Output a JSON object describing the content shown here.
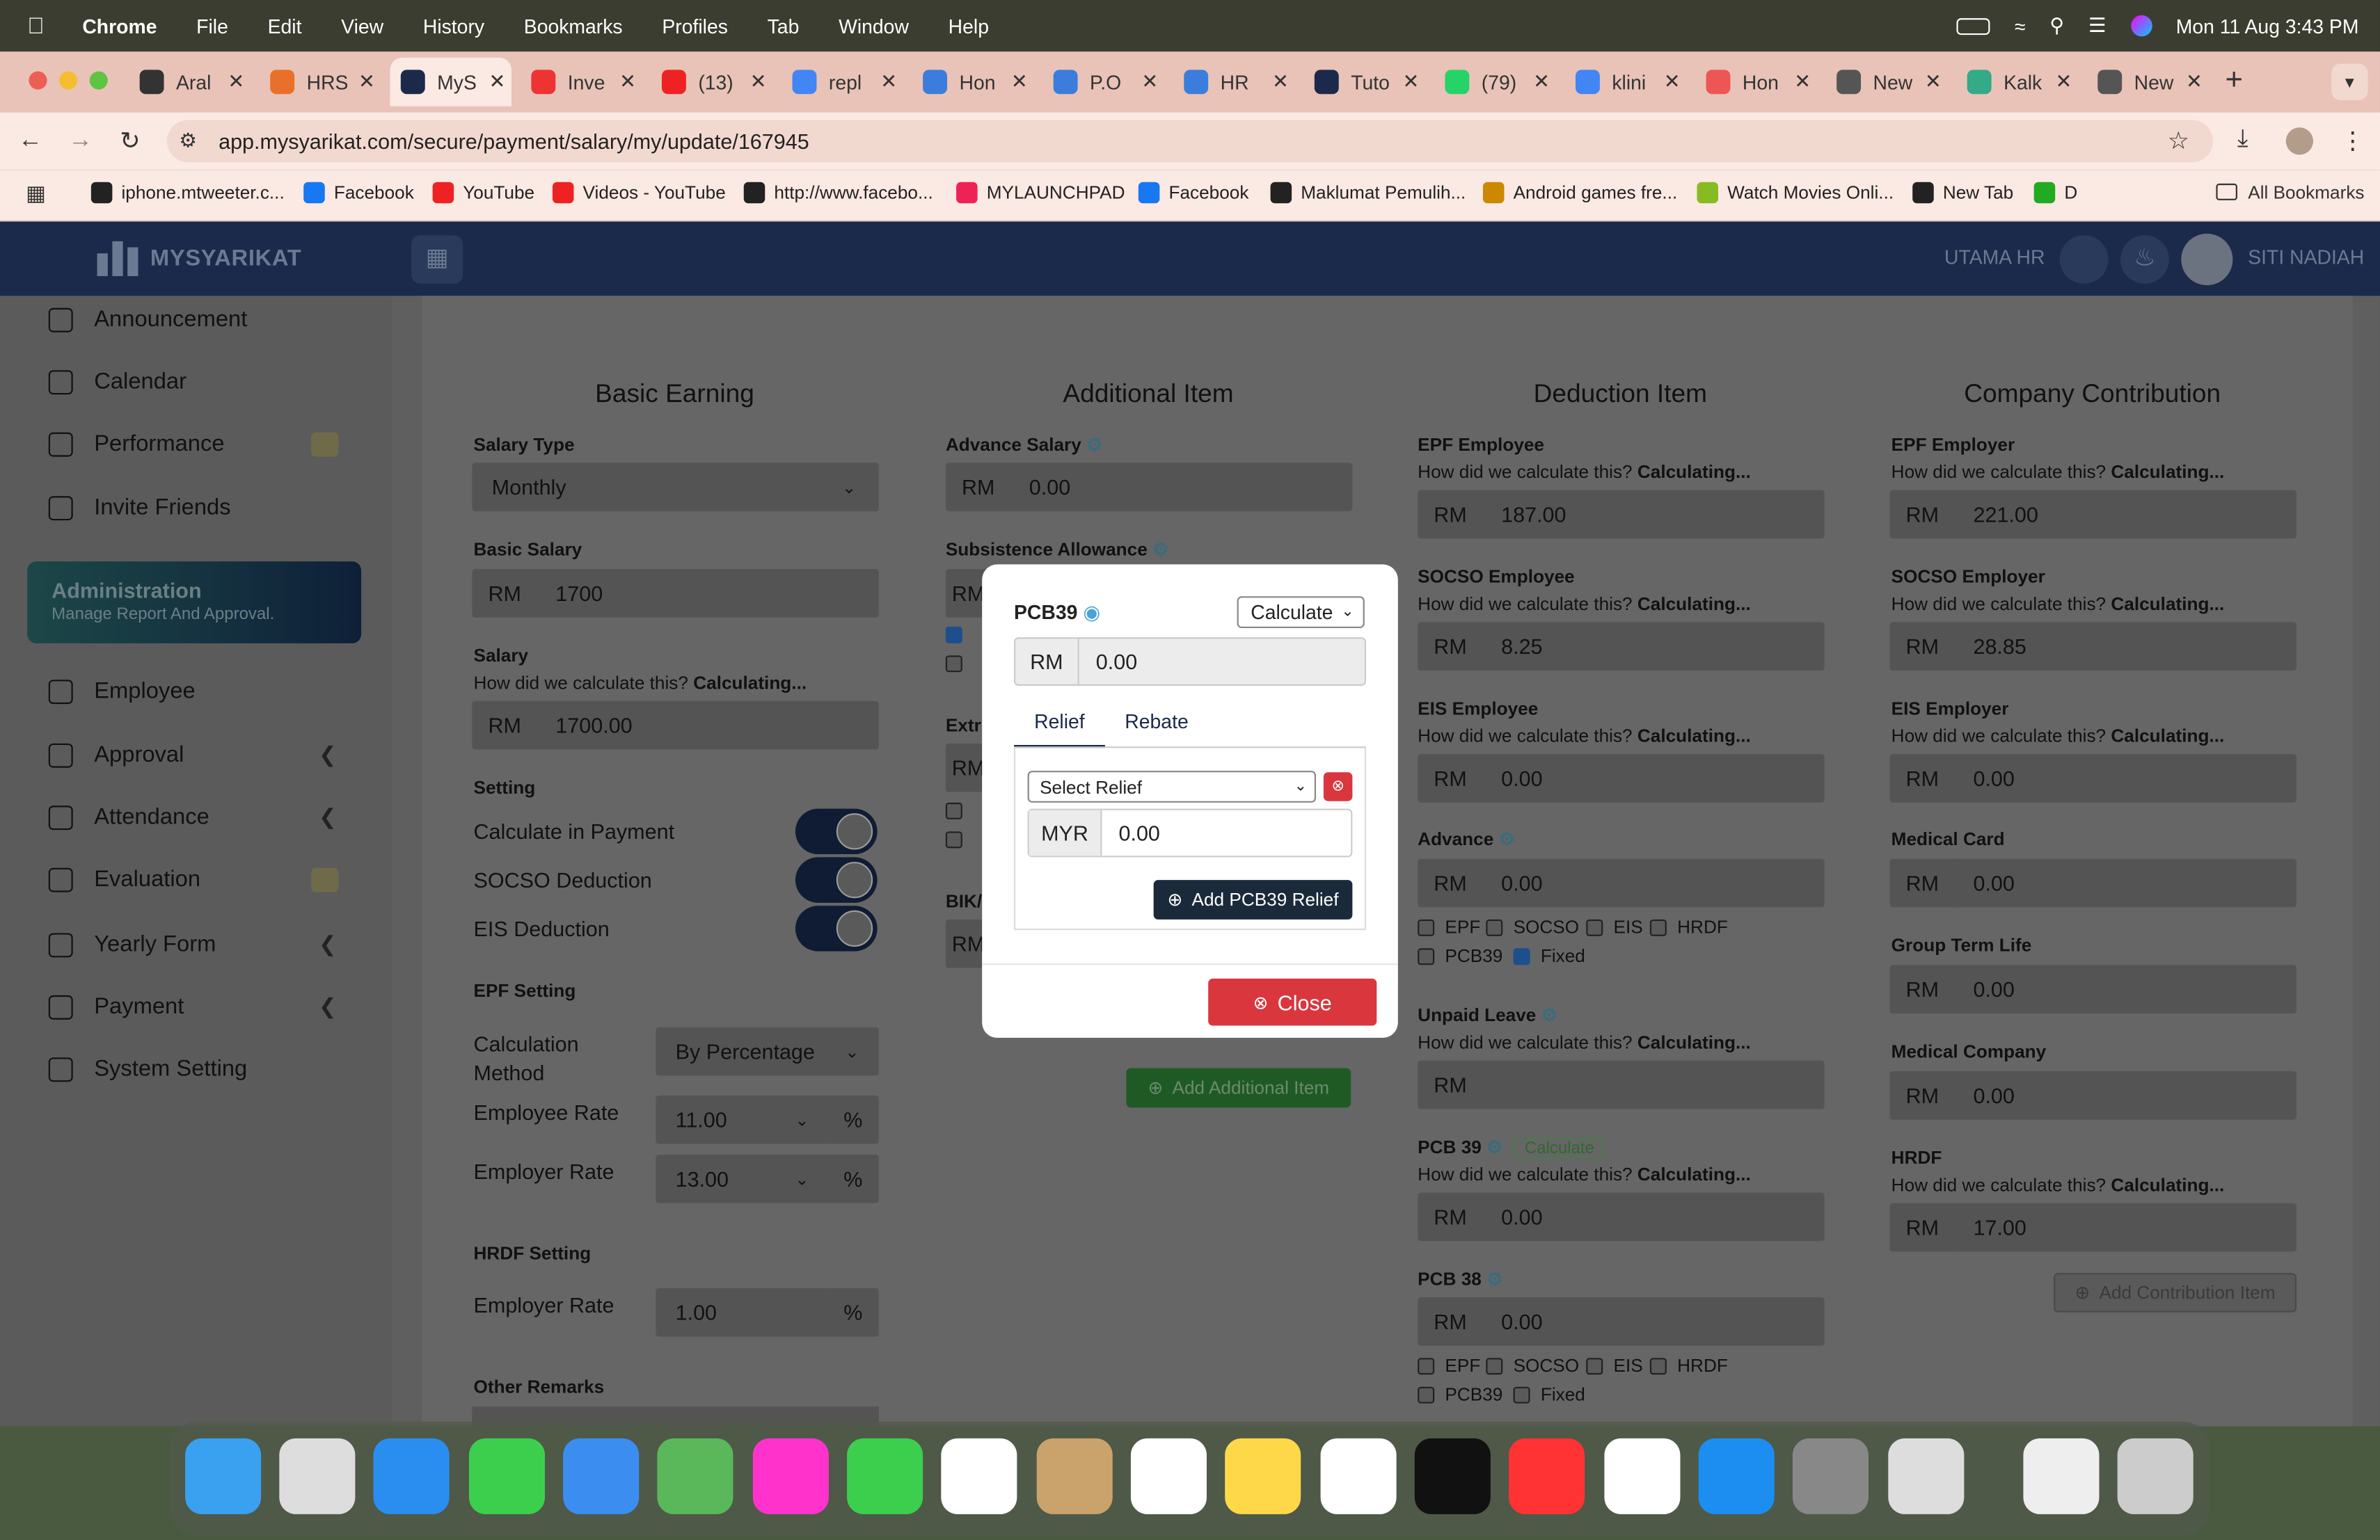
{
  "menubar": {
    "app": "Chrome",
    "items": [
      "File",
      "Edit",
      "View",
      "History",
      "Bookmarks",
      "Profiles",
      "Tab",
      "Window",
      "Help"
    ],
    "clock": "Mon 11 Aug  3:43 PM"
  },
  "tabs": [
    {
      "label": "Aral",
      "color": "#333"
    },
    {
      "label": "HRS",
      "color": "#e8702a"
    },
    {
      "label": "MyS",
      "color": "#1b2a4a"
    },
    {
      "label": "Inve",
      "color": "#e33"
    },
    {
      "label": "(13)",
      "color": "#e22"
    },
    {
      "label": "repl",
      "color": "#4285f4"
    },
    {
      "label": "Hon",
      "color": "#3b7ddd"
    },
    {
      "label": "P.O",
      "color": "#3b7ddd"
    },
    {
      "label": "HR",
      "color": "#3b7ddd"
    },
    {
      "label": "Tuto",
      "color": "#1b2a4a"
    },
    {
      "label": "(79)",
      "color": "#25d366"
    },
    {
      "label": "klini",
      "color": "#4285f4"
    },
    {
      "label": "Hon",
      "color": "#e55"
    },
    {
      "label": "New",
      "color": "#555"
    },
    {
      "label": "Kalk",
      "color": "#3a8"
    },
    {
      "label": "New",
      "color": "#555"
    }
  ],
  "url": "app.mysyarikat.com/secure/payment/salary/my/update/167945",
  "bookmarks": [
    "iphone.mtweeter.c...",
    "Facebook",
    "YouTube",
    "Videos - YouTube",
    "http://www.facebo...",
    "MYLAUNCHPAD",
    "Facebook",
    "Maklumat Pemulih...",
    "Android games fre...",
    "Watch Movies Onli...",
    "New Tab",
    "D"
  ],
  "all_bookmarks": "All Bookmarks",
  "app": {
    "brand": "MYSYARIKAT",
    "company": "UTAMA HR",
    "user": "SITI NADIAH"
  },
  "sidebar": {
    "top": [
      "Announcement",
      "Calendar",
      "Performance",
      "Invite Friends"
    ],
    "admin_title": "Administration",
    "admin_sub": "Manage Report And Approval.",
    "items": [
      "Employee",
      "Approval",
      "Attendance",
      "Evaluation",
      "Yearly Form",
      "Payment",
      "System Setting"
    ]
  },
  "basic": {
    "title": "Basic Earning",
    "salary_type_label": "Salary Type",
    "salary_type": "Monthly",
    "basic_salary_label": "Basic Salary",
    "basic_salary": "1700",
    "salary_label": "Salary",
    "how": "How did we calculate this?",
    "calculating": "Calculating...",
    "salary": "1700.00",
    "setting": "Setting",
    "calc_in_payment": "Calculate in Payment",
    "socso_deduction": "SOCSO Deduction",
    "eis_deduction": "EIS Deduction",
    "epf_setting": "EPF Setting",
    "calc_method_label": "Calculation Method",
    "calc_method": "By Percentage",
    "emp_rate_label": "Employee Rate",
    "emp_rate": "11.00",
    "er_rate_label": "Employer Rate",
    "er_rate": "13.00",
    "hrdf_setting": "HRDF Setting",
    "hrdf_rate_label": "Employer Rate",
    "hrdf_rate": "1.00",
    "other_remarks": "Other Remarks",
    "pct": "%"
  },
  "additional": {
    "title": "Additional Item",
    "advance_label": "Advance Salary",
    "advance": "0.00",
    "subsistence_label": "Subsistence Allowance",
    "extra_label": "Extr",
    "bik_label": "BIK/",
    "add_btn": "Add Additional Item"
  },
  "deduction": {
    "title": "Deduction Item",
    "epf_label": "EPF Employee",
    "epf": "187.00",
    "socso_label": "SOCSO Employee",
    "socso": "8.25",
    "eis_label": "EIS Employee",
    "eis": "0.00",
    "advance_label": "Advance",
    "advance": "0.00",
    "unpaid_label": "Unpaid Leave",
    "unpaid": "",
    "pcb39_label": "PCB 39",
    "pcb39_badge": "Calculate",
    "pcb39": "0.00",
    "pcb38_label": "PCB 38",
    "pcb38": "0.00",
    "chk": [
      "EPF",
      "SOCSO",
      "EIS",
      "HRDF",
      "PCB39",
      "Fixed"
    ]
  },
  "company": {
    "title": "Company Contribution",
    "epf_label": "EPF Employer",
    "epf": "221.00",
    "socso_label": "SOCSO Employer",
    "socso": "28.85",
    "eis_label": "EIS Employer",
    "eis": "0.00",
    "medical_card_label": "Medical Card",
    "medical_card": "0.00",
    "gtl_label": "Group Term Life",
    "gtl": "0.00",
    "medical_co_label": "Medical Company",
    "medical_co": "0.00",
    "hrdf_label": "HRDF",
    "hrdf": "17.00",
    "add_btn": "Add Contribution Item"
  },
  "currency": "RM",
  "modal": {
    "title": "PCB39",
    "mode": "Calculate",
    "amount": "0.00",
    "tab_relief": "Relief",
    "tab_rebate": "Rebate",
    "select_relief": "Select Relief",
    "myr": "MYR",
    "relief_amount": "0.00",
    "add_relief": "Add PCB39 Relief",
    "close": "Close"
  }
}
